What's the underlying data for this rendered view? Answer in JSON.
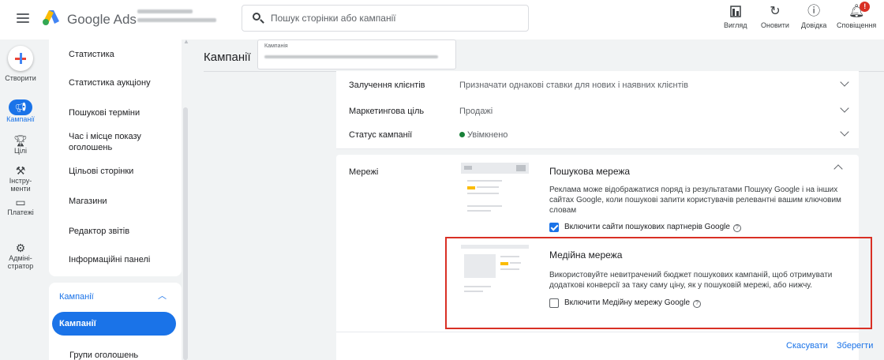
{
  "header": {
    "app_name": "Google Ads",
    "search_placeholder": "Пошук сторінки або кампанії",
    "actions": [
      {
        "label": "Вигляд",
        "icon": "view-icon"
      },
      {
        "label": "Оновити",
        "icon": "refresh-icon"
      },
      {
        "label": "Довідка",
        "icon": "help-icon"
      },
      {
        "label": "Сповіщення",
        "icon": "bell-icon",
        "badge": "!"
      }
    ]
  },
  "rail": {
    "create": "Створити",
    "items": [
      {
        "label": "Кампанії",
        "icon": "megaphone-icon"
      },
      {
        "label": "Цілі",
        "icon": "trophy-icon"
      },
      {
        "label": "Інстру-менти",
        "line1": "Інстру-",
        "line2": "менти",
        "icon": "tools-icon"
      },
      {
        "label": "Платежі",
        "icon": "card-icon"
      },
      {
        "label": "Адміні-стратор",
        "line1": "Адміні-",
        "line2": "стратор",
        "icon": "gear-icon"
      }
    ]
  },
  "sidenav": {
    "items": [
      "Статистика",
      "Статистика аукціону",
      "Пошукові терміни",
      "Час і місце показу оголошень",
      "Цільові сторінки",
      "Магазини",
      "Редактор звітів",
      "Інформаційні панелі"
    ],
    "group_header": "Кампанії",
    "group_active": "Кампанії",
    "group_item": "Групи оголошень"
  },
  "main": {
    "page_title": "Кампанії",
    "campaign_selector_label": "Кампанія",
    "rows": [
      {
        "label": "Залучення клієнтів",
        "value": "Призначати однакові ставки для нових і наявних клієнтів"
      },
      {
        "label": "Маркетингова ціль",
        "value": "Продажі"
      },
      {
        "label": "Статус кампанії",
        "value": "Увімкнено"
      }
    ],
    "networks": {
      "label": "Мережі",
      "search": {
        "title": "Пошукова мережа",
        "desc_lines": [
          "Реклама може відображатися поряд із результатами Пошуку Google і на інших",
          "сайтах Google, коли пошукові запити користувачів релевантні вашим ключовим",
          "словам"
        ],
        "checkbox_label": "Включити сайти пошукових партнерів Google",
        "checked": true
      },
      "display": {
        "title": "Медійна мережа",
        "desc_lines": [
          "Використовуйте невитрачений бюджет пошукових кампаній, щоб отримувати",
          "додаткові конверсії за таку саму ціну, як у пошуковій мережі, або нижчу."
        ],
        "checkbox_label": "Включити Медійну мережу Google",
        "checked": false
      }
    },
    "cancel": "Скасувати",
    "save": "Зберегти"
  },
  "colors": {
    "primary": "#1a73e8",
    "status_green": "#188038",
    "highlight_red": "#d93025",
    "accent_yellow": "#fbbc04"
  }
}
